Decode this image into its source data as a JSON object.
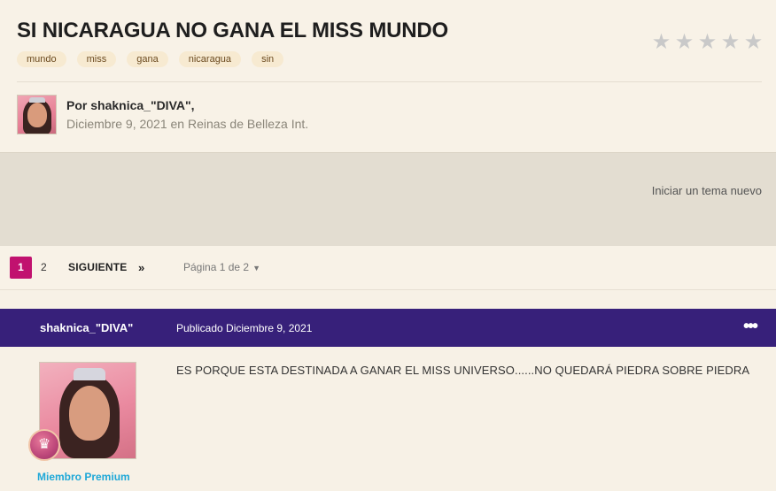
{
  "topic": {
    "title": "SI NICARAGUA NO GANA EL MISS MUNDO",
    "tags": [
      "mundo",
      "miss",
      "gana",
      "nicaragua",
      "sin"
    ],
    "author_line": "Por shaknica_\"DIVA\",",
    "meta_line": "Diciembre 9, 2021 en Reinas de Belleza Int.",
    "rating_stars": 5
  },
  "actions": {
    "new_topic": "Iniciar un tema nuevo"
  },
  "pagination": {
    "current": "1",
    "pages": [
      "2"
    ],
    "next_label": "SIGUIENTE",
    "last_icon": "»",
    "page_info": "Página 1 de 2"
  },
  "post": {
    "author": "shaknica_\"DIVA\"",
    "date": "Publicado Diciembre 9, 2021",
    "more_icon": "•••",
    "member_group": "Miembro Premium",
    "body": "ES PORQUE ESTA DESTINADA A GANAR EL MISS UNIVERSO......NO QUEDARÁ PIEDRA SOBRE PIEDRA"
  },
  "colors": {
    "accent": "#c1126f",
    "post_bar": "#37207a",
    "member_group": "#1fa8d8"
  }
}
